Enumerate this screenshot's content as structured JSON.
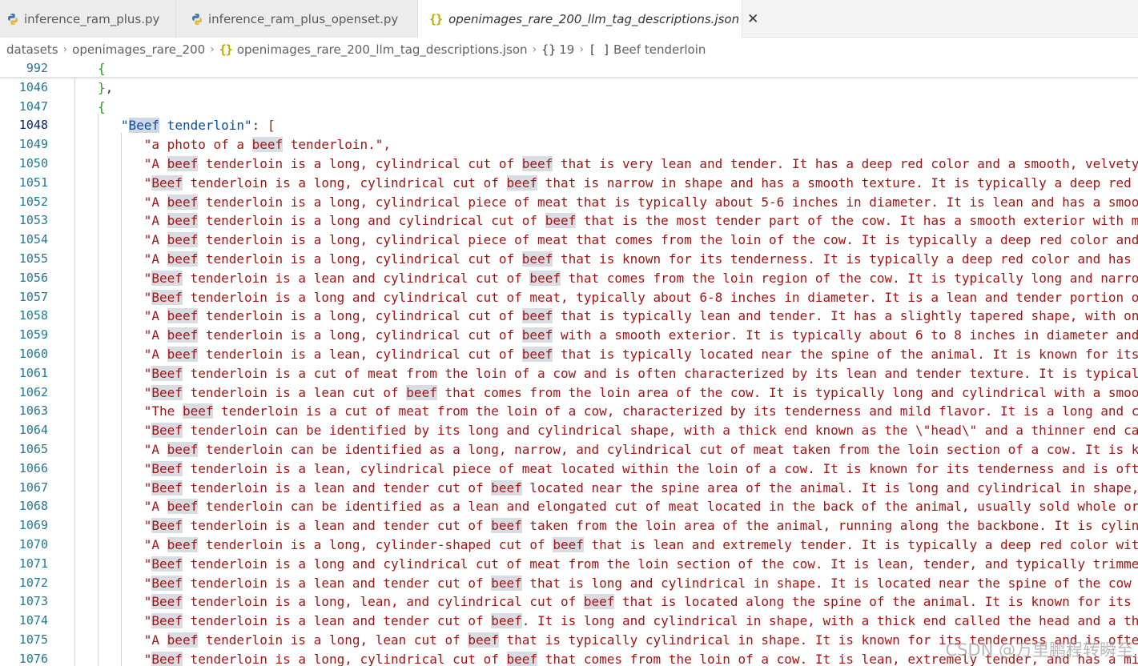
{
  "tabs": [
    {
      "label": "inference_ram_plus.py",
      "icon": "python-icon"
    },
    {
      "label": "inference_ram_plus_openset.py",
      "icon": "python-icon"
    },
    {
      "label": "openimages_rare_200_llm_tag_descriptions.json",
      "icon": "json-icon",
      "active": true
    }
  ],
  "breadcrumb": {
    "folder": "datasets",
    "subfolder": "openimages_rare_200",
    "file": "openimages_rare_200_llm_tag_descriptions.json",
    "object_index": "19",
    "array_key": "Beef tenderloin"
  },
  "editor": {
    "sticky_line": {
      "number": "992",
      "text": "{"
    },
    "lines": [
      {
        "number": "1046",
        "text": "},"
      },
      {
        "number": "1047",
        "text": "{"
      },
      {
        "number": "1048",
        "text": "\"Beef tenderloin\": ["
      },
      {
        "number": "1049",
        "text": "\"a photo of a beef tenderloin.\","
      },
      {
        "number": "1050",
        "text": "\"A beef tenderloin is a long, cylindrical cut of beef that is very lean and tender. It has a deep red color and a smooth, velvety"
      },
      {
        "number": "1051",
        "text": "\"Beef tenderloin is a long, cylindrical cut of beef that is narrow in shape and has a smooth texture. It is typically a deep red"
      },
      {
        "number": "1052",
        "text": "\"A beef tenderloin is a long, cylindrical piece of meat that is typically about 5-6 inches in diameter. It is lean and has a smoo"
      },
      {
        "number": "1053",
        "text": "\"A beef tenderloin is a long and cylindrical cut of beef that is the most tender part of the cow. It has a smooth exterior with m"
      },
      {
        "number": "1054",
        "text": "\"A beef tenderloin is a long, cylindrical piece of meat that comes from the loin of the cow. It is typically a deep red color and"
      },
      {
        "number": "1055",
        "text": "\"A beef tenderloin is a long, cylindrical cut of beef that is known for its tenderness. It is typically a deep red color and has"
      },
      {
        "number": "1056",
        "text": "\"Beef tenderloin is a lean and cylindrical cut of beef that comes from the loin region of the cow. It is typically long and narro"
      },
      {
        "number": "1057",
        "text": "\"Beef tenderloin is a long and cylindrical cut of meat, typically about 6-8 inches in diameter. It is a lean and tender portion o"
      },
      {
        "number": "1058",
        "text": "\"A beef tenderloin is a long, cylindrical cut of beef that is typically lean and tender. It has a slightly tapered shape, with on"
      },
      {
        "number": "1059",
        "text": "\"A beef tenderloin is a long, cylindrical cut of beef with a smooth exterior. It is typically about 6 to 8 inches in diameter and"
      },
      {
        "number": "1060",
        "text": "\"A beef tenderloin is a lean, cylindrical cut of beef that is typically located near the spine of the animal. It is known for its"
      },
      {
        "number": "1061",
        "text": "\"Beef tenderloin is a cut of meat from the loin of a cow and is often characterized by its lean and tender texture. It is typical"
      },
      {
        "number": "1062",
        "text": "\"Beef tenderloin is a lean cut of beef that comes from the loin area of the cow. It is typically long and cylindrical with a smoo"
      },
      {
        "number": "1063",
        "text": "\"The beef tenderloin is a cut of meat from the loin of a cow, characterized by its tenderness and mild flavor. It is a long and c"
      },
      {
        "number": "1064",
        "text": "\"Beef tenderloin can be identified by its long and cylindrical shape, with a thick end known as the \\\"head\\\" and a thinner end ca"
      },
      {
        "number": "1065",
        "text": "\"A beef tenderloin can be identified as a long, narrow, and cylindrical cut of meat taken from the loin section of a cow. It is k"
      },
      {
        "number": "1066",
        "text": "\"Beef tenderloin is a lean, cylindrical piece of meat located within the loin of a cow. It is known for its tenderness and is oft"
      },
      {
        "number": "1067",
        "text": "\"Beef tenderloin is a lean and tender cut of beef located near the spine area of the animal. It is long and cylindrical in shape,"
      },
      {
        "number": "1068",
        "text": "\"A beef tenderloin can be identified as a lean and elongated cut of meat located in the back of the animal, usually sold whole or"
      },
      {
        "number": "1069",
        "text": "\"Beef tenderloin is a lean and tender cut of beef taken from the loin area of the animal, running along the backbone. It is cylin"
      },
      {
        "number": "1070",
        "text": "\"A beef tenderloin is a long, cylinder-shaped cut of beef that is lean and extremely tender. It is typically a deep red color wit"
      },
      {
        "number": "1071",
        "text": "\"Beef tenderloin is a long and cylindrical cut of meat from the loin section of the cow. It is lean, tender, and typically trimme"
      },
      {
        "number": "1072",
        "text": "\"Beef tenderloin is a lean and tender cut of beef that is long and cylindrical in shape. It is located near the spine of the cow"
      },
      {
        "number": "1073",
        "text": "\"Beef tenderloin is a long, lean, and cylindrical cut of beef that is located along the spine of the animal. It is known for its"
      },
      {
        "number": "1074",
        "text": "\"Beef tenderloin is a lean and tender cut of beef. It is long and cylindrical in shape, with a thick end called the head and a th"
      },
      {
        "number": "1075",
        "text": "\"A beef tenderloin is a long, lean cut of beef that is typically cylindrical in shape. It is known for its tenderness and is ofte"
      },
      {
        "number": "1076",
        "text": "\"Beef tenderloin is a long, cylindrical cut of beef that comes from the loin of a cow. It is lean, extremely tender, and has a mi"
      }
    ]
  },
  "watermark": "CSDN @万里鹏程转瞬至"
}
